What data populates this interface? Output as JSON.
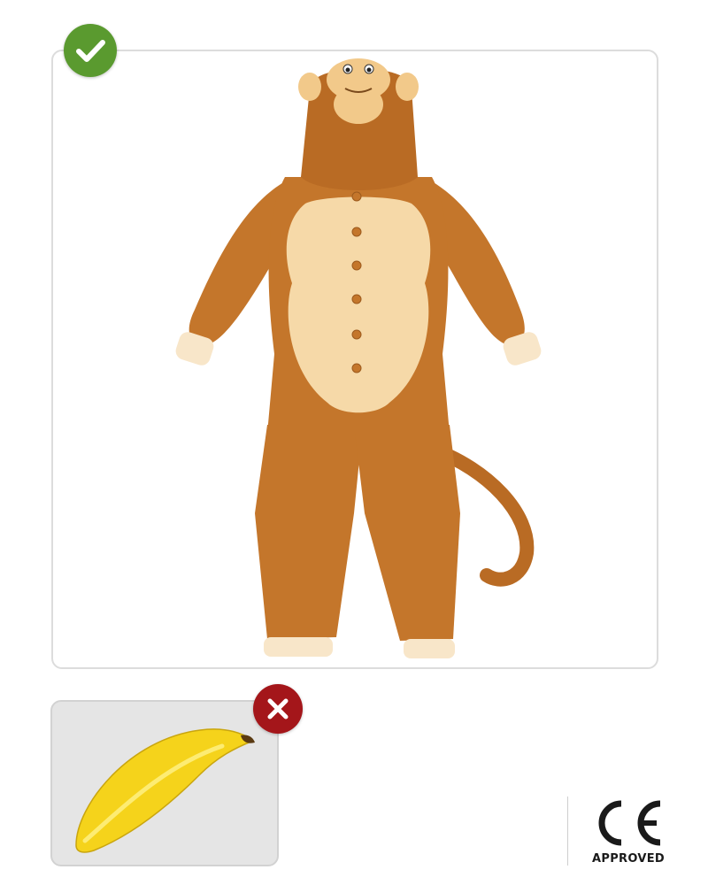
{
  "product_card": {
    "status": "approved",
    "product_image": "monkey-onesie-costume",
    "status_icon": "check-icon",
    "status_color": "#5a9a2f",
    "costume_color": "#c4762b",
    "belly_color": "#f6d9a8"
  },
  "excluded_item": {
    "status": "not-included",
    "product_image": "inflatable-banana",
    "status_icon": "close-icon",
    "status_color": "#a4161a",
    "banana_color": "#f5d31b"
  },
  "certification": {
    "mark": "CE",
    "label": "APPROVED"
  }
}
